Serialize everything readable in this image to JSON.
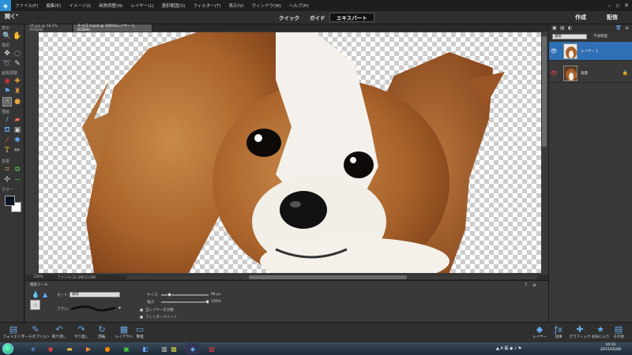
{
  "menubar": {
    "items": [
      "ファイル(F)",
      "編集(E)",
      "イメージ(I)",
      "画質調整(N)",
      "レイヤー(L)",
      "選択範囲(S)",
      "フィルター(T)",
      "表示(V)",
      "ウィンドウ(W)",
      "ヘルプ(H)"
    ]
  },
  "modebar": {
    "open": "開く",
    "tabs": [
      "クイック",
      "ガイド",
      "エキスパート"
    ],
    "create": "作成",
    "share": "配信"
  },
  "toolbox": {
    "sections": [
      "表示",
      "選択",
      "画質調整",
      "描画",
      "変更",
      "カラー"
    ]
  },
  "doc_tabs": [
    "16.jpg @ 58.3%(RGB/8)",
    "チョロ-3.psd @ 100%(レイヤー 1, RGB/8)"
  ],
  "status": {
    "zoom": "100%",
    "file_size": "ファイル:11.3M/13.0M"
  },
  "options": {
    "tool_name": "指先ツール",
    "mode_label": "モード:",
    "mode_value": "通常",
    "brush_label": "ブラシ:",
    "size_label": "サイズ:",
    "size_value": "96 px",
    "strength_label": "強さ:",
    "strength_value": "100%",
    "sample_all": "全レイヤーを対象",
    "finger_paint": "フィンガーペイント"
  },
  "layers": {
    "blend": "通常",
    "opacity_label": "不透明度:",
    "opacity": "100%",
    "items": [
      {
        "name": "レイヤー 1"
      },
      {
        "name": "背景"
      }
    ]
  },
  "bottombar": {
    "items": [
      "フォトエリア",
      "ツールオプション",
      "取り消し",
      "やり直し",
      "回転",
      "レイアウト",
      "整理"
    ],
    "right_items": [
      "レイヤー",
      "効果",
      "グラフィック",
      "お気に入り",
      "その他"
    ]
  },
  "taskbar": {
    "time": "10:31",
    "date": "2015/02/08"
  }
}
